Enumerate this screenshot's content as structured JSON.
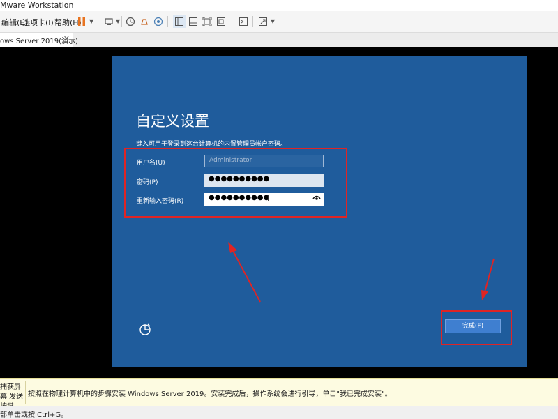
{
  "window": {
    "title": "Mware Workstation"
  },
  "menu": {
    "items": [
      "编辑(E)",
      "选项卡(I)",
      "帮助(H)"
    ]
  },
  "toolbar": {
    "icons": [
      "pause-icon",
      "send-keys-icon",
      "snapshot-icon",
      "revert-icon",
      "snapshot-manager-icon",
      "view-library-icon",
      "view-thumbnail-icon",
      "view-fit-icon",
      "view-unity-icon",
      "console-icon",
      "fullscreen-icon"
    ]
  },
  "tab": {
    "label": "ows Server 2019(演示)"
  },
  "vm": {
    "heading": "自定义设置",
    "subtitle": "键入可用于登录到这台计算机的内置管理员帐户密码。",
    "fields": {
      "username_label": "用户名(U)",
      "username_placeholder": "Administrator",
      "password_label": "密码(P)",
      "password_value": "●●●●●●●●●●",
      "confirm_label": "重新输入密码(R)",
      "confirm_value": "●●●●●●●●●●"
    },
    "finish_button": "完成(F)"
  },
  "footer": {
    "left_label": "捕获屏幕 发送按键",
    "message": "按照在物理计算机中的步骤安装 Windows Server 2019。安装完成后，操作系统会进行引导，单击\"我已完成安装\"。"
  },
  "status": {
    "text": "部单击或按 Ctrl+G。"
  },
  "colors": {
    "screen_bg": "#1f5c9c",
    "highlight_red": "#e02424",
    "finish_btn": "#3f7fd0"
  }
}
